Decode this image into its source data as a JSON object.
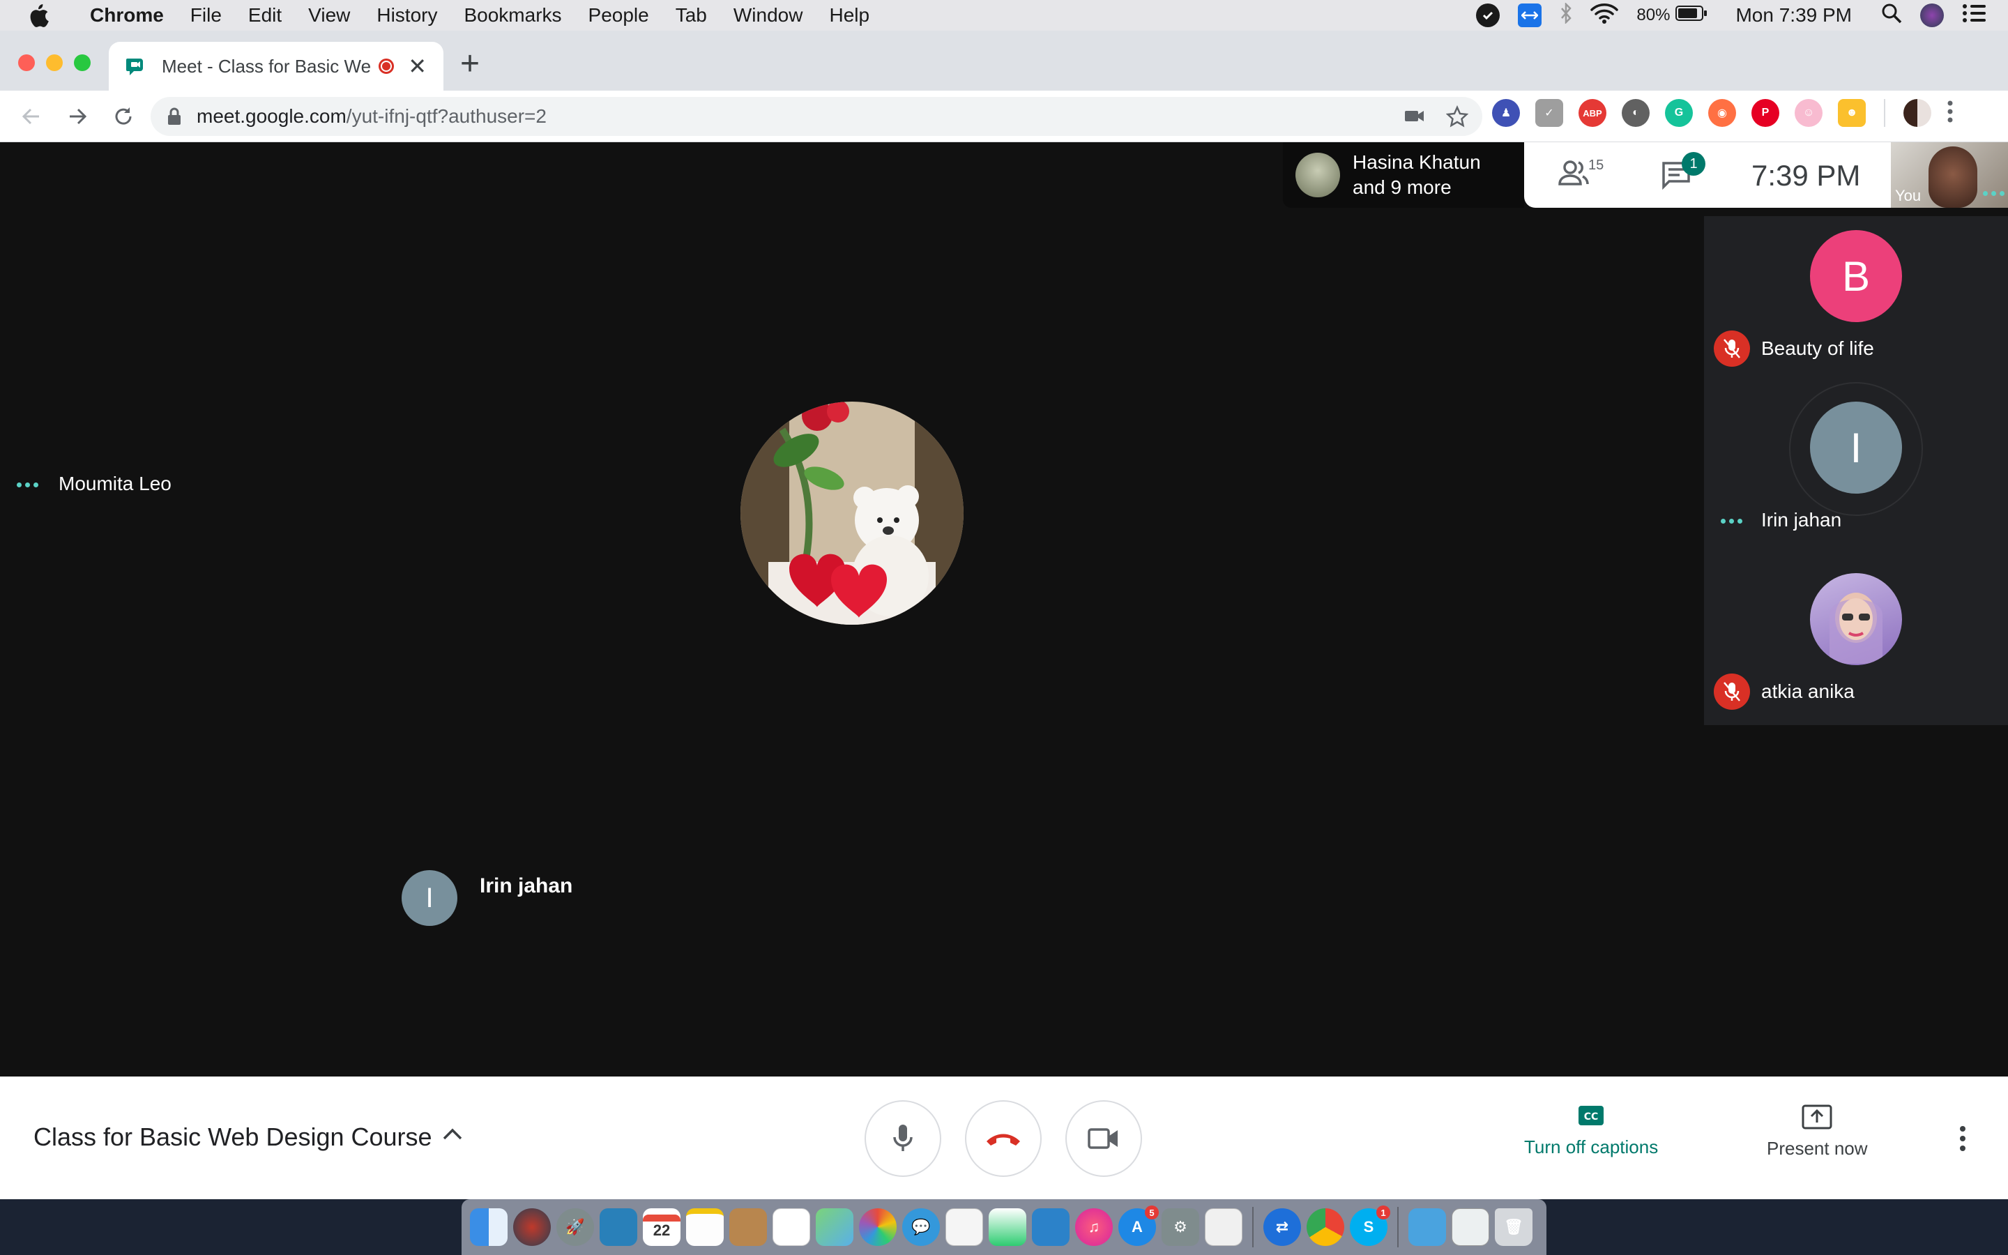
{
  "menubar": {
    "app_name": "Chrome",
    "items": [
      "File",
      "Edit",
      "View",
      "History",
      "Bookmarks",
      "People",
      "Tab",
      "Window",
      "Help"
    ],
    "battery": "80%",
    "clock": "Mon 7:39 PM"
  },
  "browser": {
    "tab_title": "Meet - Class for Basic Web Design Course",
    "url_host": "meet.google.com",
    "url_path": "/yut-ifnj-qtf?authuser=2"
  },
  "meet": {
    "top_info": {
      "line1": "Hasina Khatun",
      "line2": "and 9 more"
    },
    "participant_count": "15",
    "chat_badge": "1",
    "time": "7:39 PM",
    "self_label": "You",
    "main_tile_name": "Moumita Leo",
    "sidebar": [
      {
        "initial": "B",
        "name": "Beauty of life",
        "avatar_color": "#ec407a",
        "muted": true
      },
      {
        "initial": "I",
        "name": "Irin jahan",
        "avatar_color": "#78909c",
        "muted": false
      },
      {
        "initial": "",
        "name": "atkia anika",
        "avatar_color": "#b39ddb",
        "muted": true
      }
    ],
    "speaker": {
      "initial": "I",
      "name": "Irin jahan"
    },
    "meeting_title": "Class for Basic Web Design Course",
    "captions_label": "Turn off captions",
    "present_label": "Present now",
    "accent_color": "#00796b",
    "hangup_color": "#d93025"
  },
  "dock": {
    "calendar_day": "22",
    "appstore_badge": "5",
    "skype_badge": "1"
  }
}
